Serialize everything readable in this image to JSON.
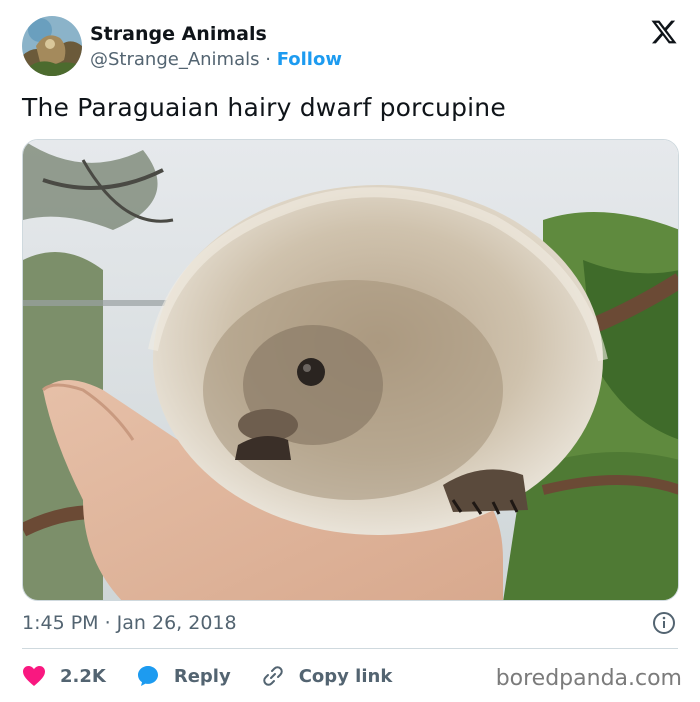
{
  "author": {
    "name": "Strange Animals",
    "handle": "@Strange_Animals",
    "separator": "·",
    "follow_label": "Follow"
  },
  "tweet": {
    "text": "The Paraguaian hairy dwarf porcupine",
    "timestamp": "1:45 PM · Jan 26, 2018"
  },
  "actions": {
    "likes": "2.2K",
    "reply_label": "Reply",
    "copy_link_label": "Copy link"
  },
  "icons": {
    "platform": "x-logo-icon",
    "like": "heart-icon",
    "reply": "speech-bubble-icon",
    "copy": "link-icon",
    "info": "info-icon"
  },
  "colors": {
    "like": "#f91880",
    "reply": "#1d9bf0",
    "follow": "#1d9bf0",
    "secondary_text": "#536471"
  },
  "watermark": "boredpanda.com"
}
